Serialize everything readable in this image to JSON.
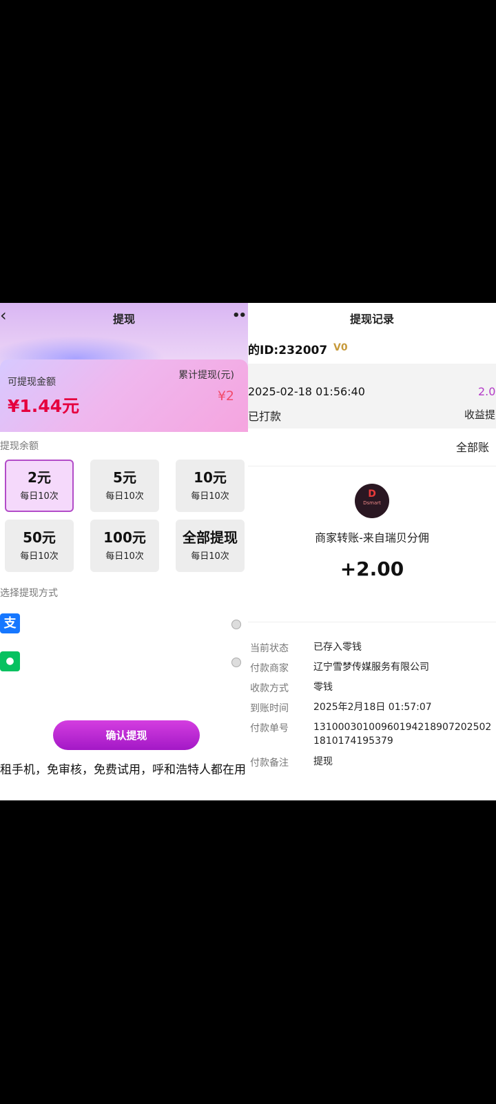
{
  "left": {
    "nav": {
      "back": "‹",
      "title": "提现",
      "more": "••"
    },
    "card": {
      "label": "可提现金额",
      "amount": "¥1.44元",
      "cum_label": "累计提现(元)",
      "cum_value": "¥2"
    },
    "section_amount": "提现余额",
    "options": [
      {
        "amount": "2元",
        "limit": "每日10次",
        "selected": true
      },
      {
        "amount": "5元",
        "limit": "每日10次",
        "selected": false
      },
      {
        "amount": "10元",
        "limit": "每日10次",
        "selected": false
      },
      {
        "amount": "50元",
        "limit": "每日10次",
        "selected": false
      },
      {
        "amount": "100元",
        "limit": "每日10次",
        "selected": false
      },
      {
        "amount": "全部提现",
        "limit": "每日10次",
        "selected": false
      }
    ],
    "section_method": "选择提现方式",
    "methods": [
      {
        "icon": "alipay-icon",
        "glyph": "支",
        "color": "#1677ff"
      },
      {
        "icon": "wechat-icon",
        "glyph": "●",
        "color": "#07c160"
      }
    ],
    "confirm_label": "确认提现",
    "promo_text": "租手机，免审核，免费试用，呼和浩特人都在用"
  },
  "right": {
    "title": "提现记录",
    "user_id": "的ID:232007",
    "level": "V0",
    "record": {
      "time": "2025-02-18 01:56:40",
      "amount": "2.0",
      "status": "已打款",
      "type": "收益提"
    },
    "all_bills": "全部账",
    "logo_letter": "D",
    "logo_text": "Dsmart",
    "merchant": "商家转账-来自瑞贝分佣",
    "amount": "+2.00",
    "details": [
      {
        "key": "当前状态",
        "value": "已存入零钱"
      },
      {
        "key": "付款商家",
        "value": "辽宁雪梦传媒服务有限公司"
      },
      {
        "key": "收款方式",
        "value": "零钱"
      },
      {
        "key": "到账时间",
        "value": "2025年2月18日 01:57:07"
      },
      {
        "key": "付款单号",
        "value": "131000301009601942189072025021810174195379"
      },
      {
        "key": "付款备注",
        "value": "提现"
      }
    ],
    "colors": {
      "accent": "#b33ac7",
      "level": "#c79a3b"
    }
  }
}
